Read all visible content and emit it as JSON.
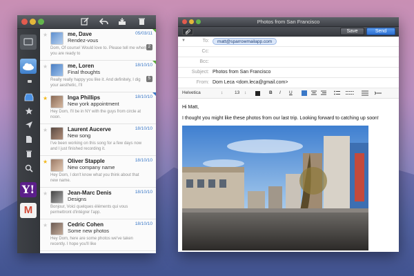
{
  "mail_list": {
    "toolbar": {
      "compose_icon": "compose-icon",
      "reply_icon": "reply-icon",
      "archive_icon": "archive-icon",
      "trash_icon": "trash-icon"
    },
    "rail": {
      "icons": [
        "inbox-icon",
        "star-icon",
        "send-icon",
        "document-icon",
        "trash-icon",
        "search-icon"
      ],
      "accounts": [
        "cloud-account",
        "yahoo-account",
        "gmail-account"
      ],
      "yahoo_letter": "Y!",
      "gmail_letter": "M",
      "footer_icon": "tag-icon"
    },
    "messages": [
      {
        "sender": "me, Dave",
        "date": "05/03/11",
        "subject": "Rendez-vous",
        "preview": "Dom, Of course! Would love to. Please tell me when you are ready to",
        "count": "2",
        "starred": false,
        "corner": "green"
      },
      {
        "sender": "me, Loren",
        "date": "18/10/10",
        "subject": "Final thoughts",
        "preview": "Really really happy you like it. And definitely, I dig your aesthetic, I'll",
        "count": "5",
        "starred": false,
        "corner": "green"
      },
      {
        "sender": "Inga Phillips",
        "date": "18/10/10",
        "subject": "New york appointment",
        "preview": "Hey Dom, I'll be in NY with the guys from circle at noon.",
        "count": "",
        "starred": true,
        "corner": "blue"
      },
      {
        "sender": "Laurent Aucerve",
        "date": "18/10/10",
        "subject": "New song",
        "preview": "I've been working on this song for a few days now and I just finished recording it.",
        "count": "",
        "starred": false,
        "corner": ""
      },
      {
        "sender": "Oliver Stapple",
        "date": "18/10/10",
        "subject": "New company name",
        "preview": "Hey Dom, I don't know what you think about that new name.",
        "count": "",
        "starred": true,
        "corner": ""
      },
      {
        "sender": "Jean-Marc Denis",
        "date": "18/10/10",
        "subject": "Designs",
        "preview": "Bonjour, Voici quelques éléments qui vous permettront d'intégrer l'app.",
        "count": "",
        "starred": false,
        "corner": ""
      },
      {
        "sender": "Cedric Cohen",
        "date": "18/10/10",
        "subject": "Some new photos",
        "preview": "Hey Dom, here are some photos we've taken recently. I hope you'll like",
        "count": "",
        "starred": false,
        "corner": ""
      }
    ]
  },
  "compose": {
    "title": "Photos from San Francisco",
    "attach_icon": "paperclip-icon",
    "save_label": "Save",
    "send_label": "Send",
    "fields": {
      "to_label": "To:",
      "to_value": "matt@sparrowmailapp.com",
      "cc_label": "Cc:",
      "bcc_label": "Bcc:",
      "subject_label": "Subject:",
      "subject_value": "Photos from San Francisco",
      "from_label": "From:",
      "from_value": "Dom Leca <dom.leca@gmail.com>"
    },
    "format": {
      "font": "Helvetica",
      "size": "13",
      "bold": "B",
      "italic": "I",
      "underline": "U"
    },
    "body": {
      "greeting": "Hi Matt,",
      "line1": "I thought you might like these photos from our last trip. Looking forward to catching up soon!"
    }
  },
  "colors": {
    "accent_blue": "#3a78c7",
    "send_blue": "#2d6fd0",
    "star_yellow": "#f2b81c"
  }
}
